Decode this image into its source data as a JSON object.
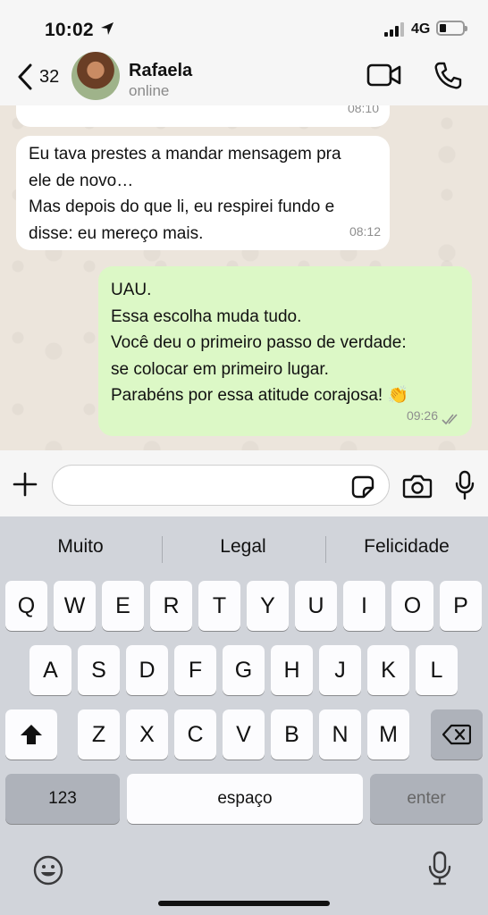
{
  "status_bar": {
    "time": "10:02",
    "network": "4G"
  },
  "header": {
    "back_count": "32",
    "contact_name": "Rafaela",
    "contact_status": "online"
  },
  "messages": [
    {
      "direction": "in",
      "lines": [],
      "time": "08:10"
    },
    {
      "direction": "in",
      "lines": [
        "Eu tava prestes a mandar mensagem pra",
        "ele de novo…",
        "Mas depois do que li, eu respirei fundo e",
        "disse: eu mereço mais."
      ],
      "time": "08:12"
    },
    {
      "direction": "out",
      "lines": [
        "UAU.",
        "Essa escolha muda tudo.",
        "Você deu o primeiro passo de verdade:",
        "se colocar em primeiro lugar.",
        "Parabéns por essa atitude corajosa! 👏"
      ],
      "time": "09:26",
      "status": "read"
    }
  ],
  "input": {
    "value": "",
    "placeholder": ""
  },
  "keyboard": {
    "suggestions": [
      "Muito",
      "Legal",
      "Felicidade"
    ],
    "rows": [
      [
        "Q",
        "W",
        "E",
        "R",
        "T",
        "Y",
        "U",
        "I",
        "O",
        "P"
      ],
      [
        "A",
        "S",
        "D",
        "F",
        "G",
        "H",
        "J",
        "K",
        "L"
      ],
      [
        "Z",
        "X",
        "C",
        "V",
        "B",
        "N",
        "M"
      ]
    ],
    "numbers_label": "123",
    "space_label": "espaço",
    "enter_label": "enter"
  },
  "colors": {
    "outgoing_bubble": "#dcf8c6",
    "incoming_bubble": "#ffffff",
    "chat_background": "#ece5dc",
    "keyboard_background": "#d1d4da"
  }
}
